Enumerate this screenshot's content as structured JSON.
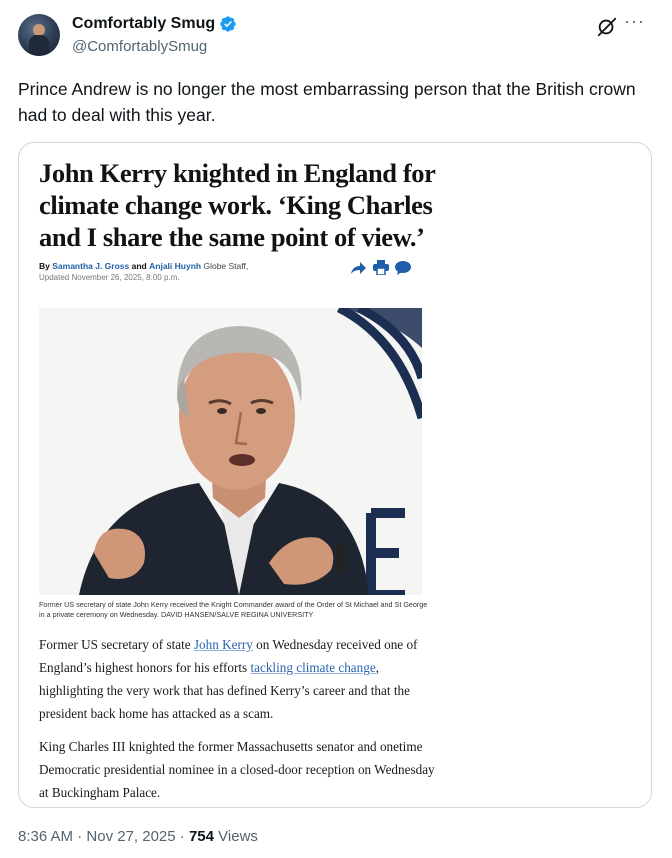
{
  "author": {
    "display_name": "Comfortably Smug",
    "handle": "@ComfortablySmug",
    "verified": true,
    "verified_color": "#1d9bf0"
  },
  "header_icons": [
    "grok-icon",
    "more-icon"
  ],
  "tweet": {
    "text": "Prince Andrew is no longer the most embarrassing person that the British crown had to deal with this year."
  },
  "card": {
    "headline": "John Kerry knighted in England for climate change work. ‘King Charles and I share the same point of view.’",
    "byline_prefix": "By",
    "author_1": "Samantha J. Gross",
    "byline_and": "and",
    "author_2": "Anjali Huynh",
    "byline_suffix": "Globe Staff,",
    "updated": "Updated November 26, 2025, 8:00 p.m.",
    "share_icons": [
      "share-icon",
      "print-icon",
      "comment-icon"
    ],
    "photo_caption": "Former US secretary of state John Kerry received the Knight Commander award of the Order of St Michael and St George in a private ceremony on Wednesday. DAVID HANSEN/SALVE REGINA UNIVERSITY",
    "para1": {
      "t1": "Former US secretary of state ",
      "link1": "John Kerry",
      "t2": " on Wednesday received one of England’s highest honors for his efforts ",
      "link2": "tackling climate change",
      "t3": ", highlighting the very work that has defined Kerry’s career and that the president back home has attacked as a scam."
    },
    "para2": "King Charles III knighted the former Massachusetts senator and onetime Democratic presidential nominee in a closed-door reception on Wednesday at Buckingham Palace."
  },
  "footer": {
    "time": "8:36 AM",
    "sep1": " · ",
    "date": "Nov 27, 2025",
    "sep2": " · ",
    "views": "754",
    "views_label": " Views"
  }
}
